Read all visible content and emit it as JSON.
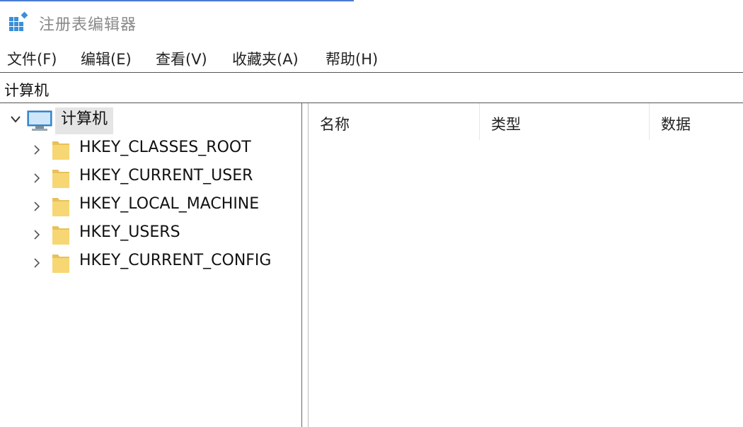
{
  "window": {
    "title": "注册表编辑器"
  },
  "menu": {
    "items": [
      {
        "label": "文件(F)"
      },
      {
        "label": "编辑(E)"
      },
      {
        "label": "查看(V)"
      },
      {
        "label": "收藏夹(A)"
      },
      {
        "label": "帮助(H)"
      }
    ]
  },
  "address": {
    "path": "计算机"
  },
  "tree": {
    "root": {
      "label": "计算机",
      "expanded": true,
      "selected": true
    },
    "nodes": [
      {
        "label": "HKEY_CLASSES_ROOT"
      },
      {
        "label": "HKEY_CURRENT_USER"
      },
      {
        "label": "HKEY_LOCAL_MACHINE"
      },
      {
        "label": "HKEY_USERS"
      },
      {
        "label": "HKEY_CURRENT_CONFIG"
      }
    ]
  },
  "list": {
    "columns": [
      {
        "label": "名称"
      },
      {
        "label": "类型"
      },
      {
        "label": "数据"
      }
    ]
  },
  "colors": {
    "folder": "#f7d774",
    "folder_dark": "#e8c15a",
    "selection": "#e5e5e5",
    "monitor": "#3b8fd8"
  }
}
